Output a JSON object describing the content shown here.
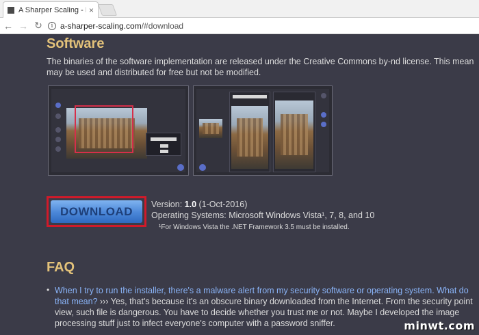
{
  "browser": {
    "tab_title": "A Sharper Scaling - Hig",
    "tab_close": "×",
    "url_host": "a-sharper-scaling.com",
    "url_path": "/#download",
    "back_icon": "arrow-left",
    "forward_icon": "arrow-right",
    "reload_icon": "reload",
    "info_icon": "i"
  },
  "software": {
    "heading": "Software",
    "line1": "The binaries of the software implementation are released under the Creative Commons by-nd license. This mean",
    "line2": "may be used and distributed for free but not be modified."
  },
  "download": {
    "button_label": "DOWNLOAD",
    "version_prefix": "Version: ",
    "version_number": "1.0",
    "version_date": " (1-Oct-2016)",
    "os_line": "Operating Systems: Microsoft Windows Vista¹, 7, 8, and 10",
    "footnote": "¹For Windows Vista the .NET Framework 3.5 must be installed."
  },
  "faq": {
    "heading": "FAQ",
    "bullet": "•",
    "q1_link_line1": "When I try to run the installer, there's a malware alert from my security software or operating system. What do",
    "q1_link_line2": "that mean?",
    "q1_answer_line2": " ››› Yes, that's because it's an obscure binary downloaded from the Internet. From the security point",
    "q1_answer_line3": "view, such file is dangerous. You have to decide whether you trust me or not. Maybe I developed the image",
    "q1_answer_line4": "processing stuff just to infect everyone's computer with a password sniffer."
  },
  "watermark": "minwt.com",
  "colors": {
    "page_bg": "#3b3b48",
    "heading": "#e3c27a",
    "link": "#8ab4f8",
    "download_border": "#d01a2a"
  }
}
